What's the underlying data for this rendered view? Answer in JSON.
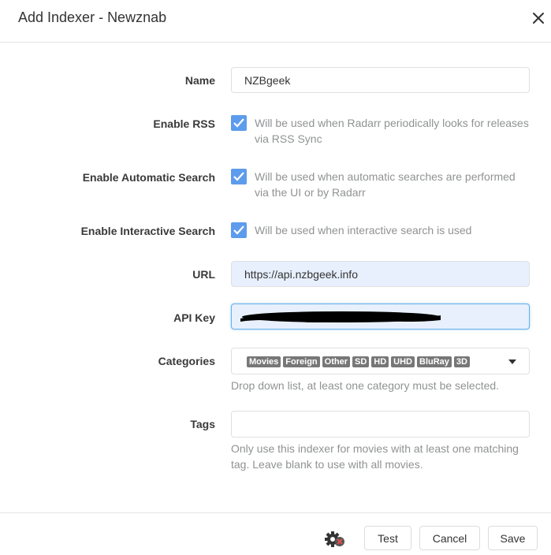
{
  "modal": {
    "title": "Add Indexer - Newznab"
  },
  "fields": {
    "name": {
      "label": "Name",
      "value": "NZBgeek"
    },
    "enable_rss": {
      "label": "Enable RSS",
      "checked": true,
      "help": "Will be used when Radarr periodically looks for releases via RSS Sync"
    },
    "enable_auto": {
      "label": "Enable Automatic Search",
      "checked": true,
      "help": "Will be used when automatic searches are performed via the UI or by Radarr"
    },
    "enable_interactive": {
      "label": "Enable Interactive Search",
      "checked": true,
      "help": "Will be used when interactive search is used"
    },
    "url": {
      "label": "URL",
      "value": "https://api.nzbgeek.info"
    },
    "api_key": {
      "label": "API Key",
      "value_redacted": true
    },
    "categories": {
      "label": "Categories",
      "chips": [
        "Movies",
        "Foreign",
        "Other",
        "SD",
        "HD",
        "UHD",
        "BluRay",
        "3D"
      ],
      "help": "Drop down list, at least one category must be selected."
    },
    "tags": {
      "label": "Tags",
      "value": "",
      "help": "Only use this indexer for movies with at least one matching tag. Leave blank to use with all movies."
    }
  },
  "footer": {
    "test": "Test",
    "cancel": "Cancel",
    "save": "Save"
  },
  "icons": {
    "close": "close-icon",
    "settings": "gear-icon"
  },
  "colors": {
    "accent": "#5d9cec",
    "focus_border": "#66afe9",
    "chip_bg": "#777777"
  }
}
